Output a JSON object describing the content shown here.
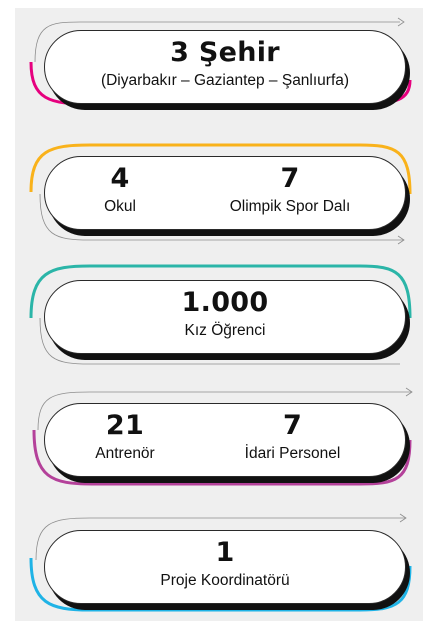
{
  "cards": [
    {
      "number": "3 Şehir",
      "label": "(Diyarbakır – Gaziantep – Şanlıurfa)",
      "color": "#e6007e"
    },
    {
      "left": {
        "number": "4",
        "label": "Okul"
      },
      "right": {
        "number": "7",
        "label": "Olimpik Spor Dalı"
      },
      "color": "#f9b21b"
    },
    {
      "number": "1.000",
      "label": "Kız Öğrenci",
      "color": "#2bb5a8"
    },
    {
      "left": {
        "number": "21",
        "label": "Antrenör"
      },
      "right": {
        "number": "7",
        "label": "İdari Personel"
      },
      "color": "#b4419a"
    },
    {
      "number": "1",
      "label": "Proje Koordinatörü",
      "color": "#1fb3e6"
    }
  ]
}
